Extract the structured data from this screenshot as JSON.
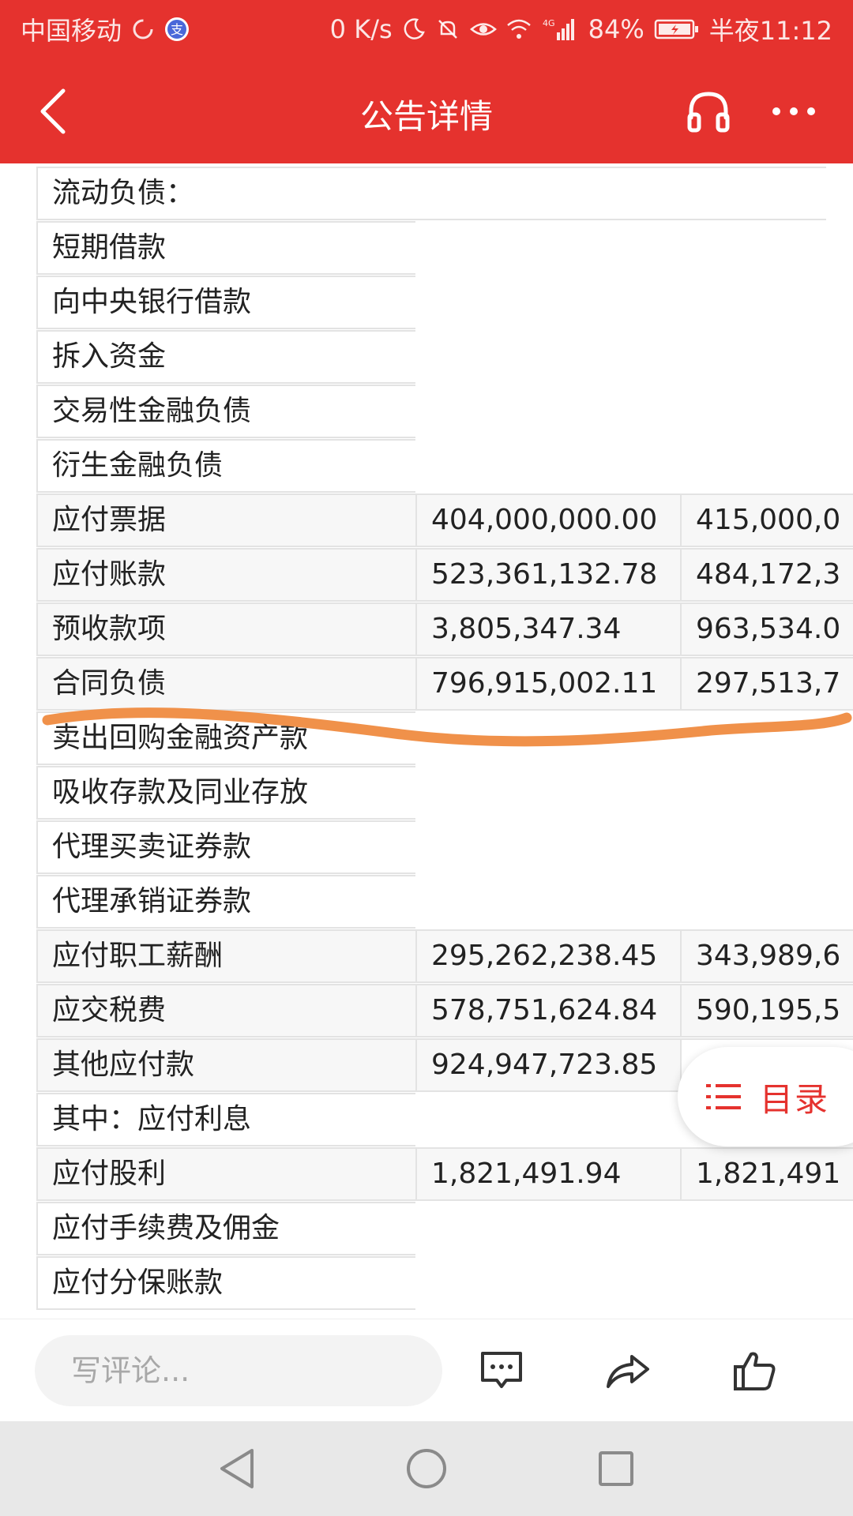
{
  "status_bar": {
    "carrier": "中国移动",
    "net_speed": "0 K/s",
    "battery": "84%",
    "time": "半夜11:12",
    "network_type": "4G"
  },
  "header": {
    "title": "公告详情"
  },
  "table": {
    "section_title": "流动负债：",
    "rows": [
      {
        "label": "短期借款",
        "current": "",
        "previous": ""
      },
      {
        "label": "向中央银行借款",
        "current": "",
        "previous": ""
      },
      {
        "label": "拆入资金",
        "current": "",
        "previous": ""
      },
      {
        "label": "交易性金融负债",
        "current": "",
        "previous": ""
      },
      {
        "label": "衍生金融负债",
        "current": "",
        "previous": ""
      },
      {
        "label": "应付票据",
        "current": "404,000,000.00",
        "previous": "415,000,0"
      },
      {
        "label": "应付账款",
        "current": "523,361,132.78",
        "previous": "484,172,3"
      },
      {
        "label": "预收款项",
        "current": "3,805,347.34",
        "previous": "963,534.0"
      },
      {
        "label": "合同负债",
        "current": "796,915,002.11",
        "previous": "297,513,7"
      },
      {
        "label": "卖出回购金融资产款",
        "current": "",
        "previous": ""
      },
      {
        "label": "吸收存款及同业存放",
        "current": "",
        "previous": ""
      },
      {
        "label": "代理买卖证券款",
        "current": "",
        "previous": ""
      },
      {
        "label": "代理承销证券款",
        "current": "",
        "previous": ""
      },
      {
        "label": "应付职工薪酬",
        "current": "295,262,238.45",
        "previous": "343,989,6"
      },
      {
        "label": "应交税费",
        "current": "578,751,624.84",
        "previous": "590,195,5"
      },
      {
        "label": "其他应付款",
        "current": "924,947,723.85",
        "previous": ""
      },
      {
        "label": "其中：应付利息",
        "current": "",
        "previous": ""
      },
      {
        "label": "应付股利",
        "current": "1,821,491.94",
        "previous": "1,821,491"
      },
      {
        "label": "应付手续费及佣金",
        "current": "",
        "previous": ""
      },
      {
        "label": "应付分保账款",
        "current": "",
        "previous": ""
      }
    ]
  },
  "toc_button": {
    "label": "目录"
  },
  "comment_bar": {
    "placeholder": "写评论..."
  },
  "colors": {
    "brand_red": "#e5322e",
    "annotation_orange": "#f0914a"
  },
  "icons": {
    "back": "back-arrow-icon",
    "listen": "headphones-icon",
    "more": "more-dots-icon",
    "toc": "list-icon",
    "comments": "comment-icon",
    "share": "share-icon",
    "like": "thumbs-up-icon"
  }
}
